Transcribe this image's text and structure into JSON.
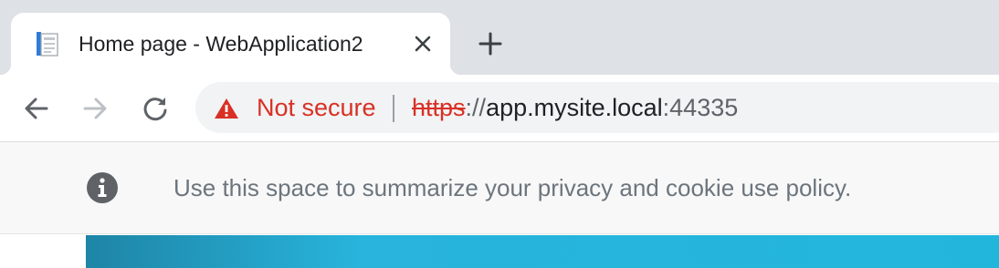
{
  "tab": {
    "title": "Home page - WebApplication2",
    "favicon": "document-page-icon",
    "close_icon": "close-icon"
  },
  "new_tab_icon": "plus-icon",
  "toolbar": {
    "back_icon": "arrow-left-icon",
    "forward_icon": "arrow-right-icon",
    "reload_icon": "reload-icon"
  },
  "omnibox": {
    "security_icon": "warning-triangle-icon",
    "security_label": "Not secure",
    "url_scheme": "https",
    "url_sep": "://",
    "url_host": "app.mysite.local",
    "url_port": ":44335"
  },
  "cookie_banner": {
    "icon": "info-icon",
    "message": "Use this space to summarize your privacy and cookie use policy."
  },
  "colors": {
    "tabstrip_bg": "#dee1e6",
    "not_secure": "#d93025",
    "banner_bg": "#f8f8f8",
    "hero_accent": "#23b6dd"
  }
}
